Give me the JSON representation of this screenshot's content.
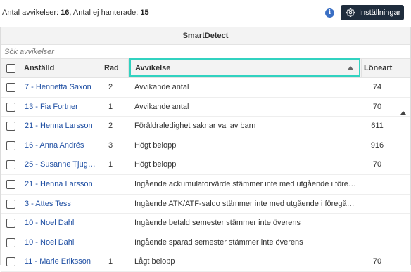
{
  "summary": {
    "deviations_label": "Antal avvikelser:",
    "deviations_count": "16",
    "unhandled_label": "Antal ej hanterade:",
    "unhandled_count": "15"
  },
  "toolbar": {
    "settings_label": "Inställningar",
    "info_icon": "info-icon",
    "settings_icon": "gear-icon"
  },
  "panel": {
    "title": "SmartDetect"
  },
  "search": {
    "placeholder": "Sök avvikelser"
  },
  "columns": {
    "employee": "Anställd",
    "row": "Rad",
    "deviation": "Avvikelse",
    "wage_type": "Löneart"
  },
  "sort": {
    "column": "Avvikelse",
    "direction": "ascending"
  },
  "rows": [
    {
      "employee": "7 - Henrietta Saxon",
      "row": "2",
      "deviation": "Avvikande antal",
      "wage_type": "74"
    },
    {
      "employee": "13 - Fia Fortner",
      "row": "1",
      "deviation": "Avvikande antal",
      "wage_type": "70"
    },
    {
      "employee": "21 - Henna Larsson",
      "row": "2",
      "deviation": "Föräldraledighet saknar val av barn",
      "wage_type": "611"
    },
    {
      "employee": "16 - Anna Andrés",
      "row": "3",
      "deviation": "Högt belopp",
      "wage_type": "916"
    },
    {
      "employee": "25 - Susanne Tjugotv...",
      "row": "1",
      "deviation": "Högt belopp",
      "wage_type": "70"
    },
    {
      "employee": "21 - Henna Larsson",
      "row": "",
      "deviation": "Ingående ackumulatorvärde stämmer inte med utgående i föregåend...",
      "wage_type": ""
    },
    {
      "employee": "3 - Attes Tess",
      "row": "",
      "deviation": "Ingående ATK/ATF-saldo stämmer inte med utgående i föregående lö...",
      "wage_type": ""
    },
    {
      "employee": "10 - Noel Dahl",
      "row": "",
      "deviation": "Ingående betald semester stämmer inte överens",
      "wage_type": ""
    },
    {
      "employee": "10 - Noel Dahl",
      "row": "",
      "deviation": "Ingående sparad semester stämmer inte överens",
      "wage_type": ""
    },
    {
      "employee": "11 - Marie Eriksson",
      "row": "1",
      "deviation": "Lågt belopp",
      "wage_type": "70"
    }
  ],
  "colors": {
    "link": "#1f4fa3",
    "button_bg": "#1f2d3d",
    "highlight": "#31d2c0",
    "info": "#3a6fc4"
  }
}
